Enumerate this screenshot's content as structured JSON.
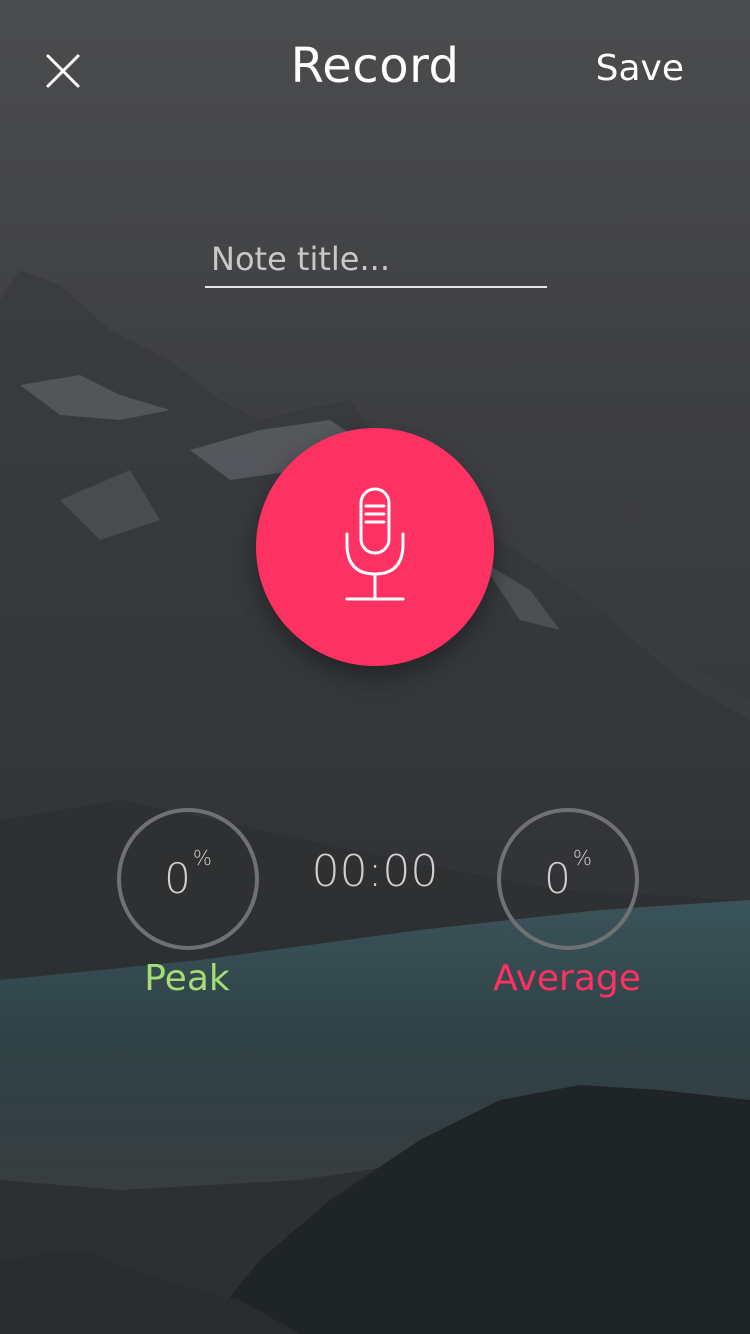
{
  "header": {
    "close_icon": "close-icon",
    "title": "Record",
    "save_label": "Save"
  },
  "note": {
    "placeholder": "Note title...",
    "value": ""
  },
  "record_button": {
    "icon": "microphone-icon",
    "color": "#fe3163"
  },
  "timer": {
    "value": "00:00"
  },
  "meters": {
    "peak": {
      "value": "0",
      "unit": "%",
      "label": "Peak",
      "color": "#a4dd76"
    },
    "average": {
      "value": "0",
      "unit": "%",
      "label": "Average",
      "color": "#fe3163"
    }
  }
}
